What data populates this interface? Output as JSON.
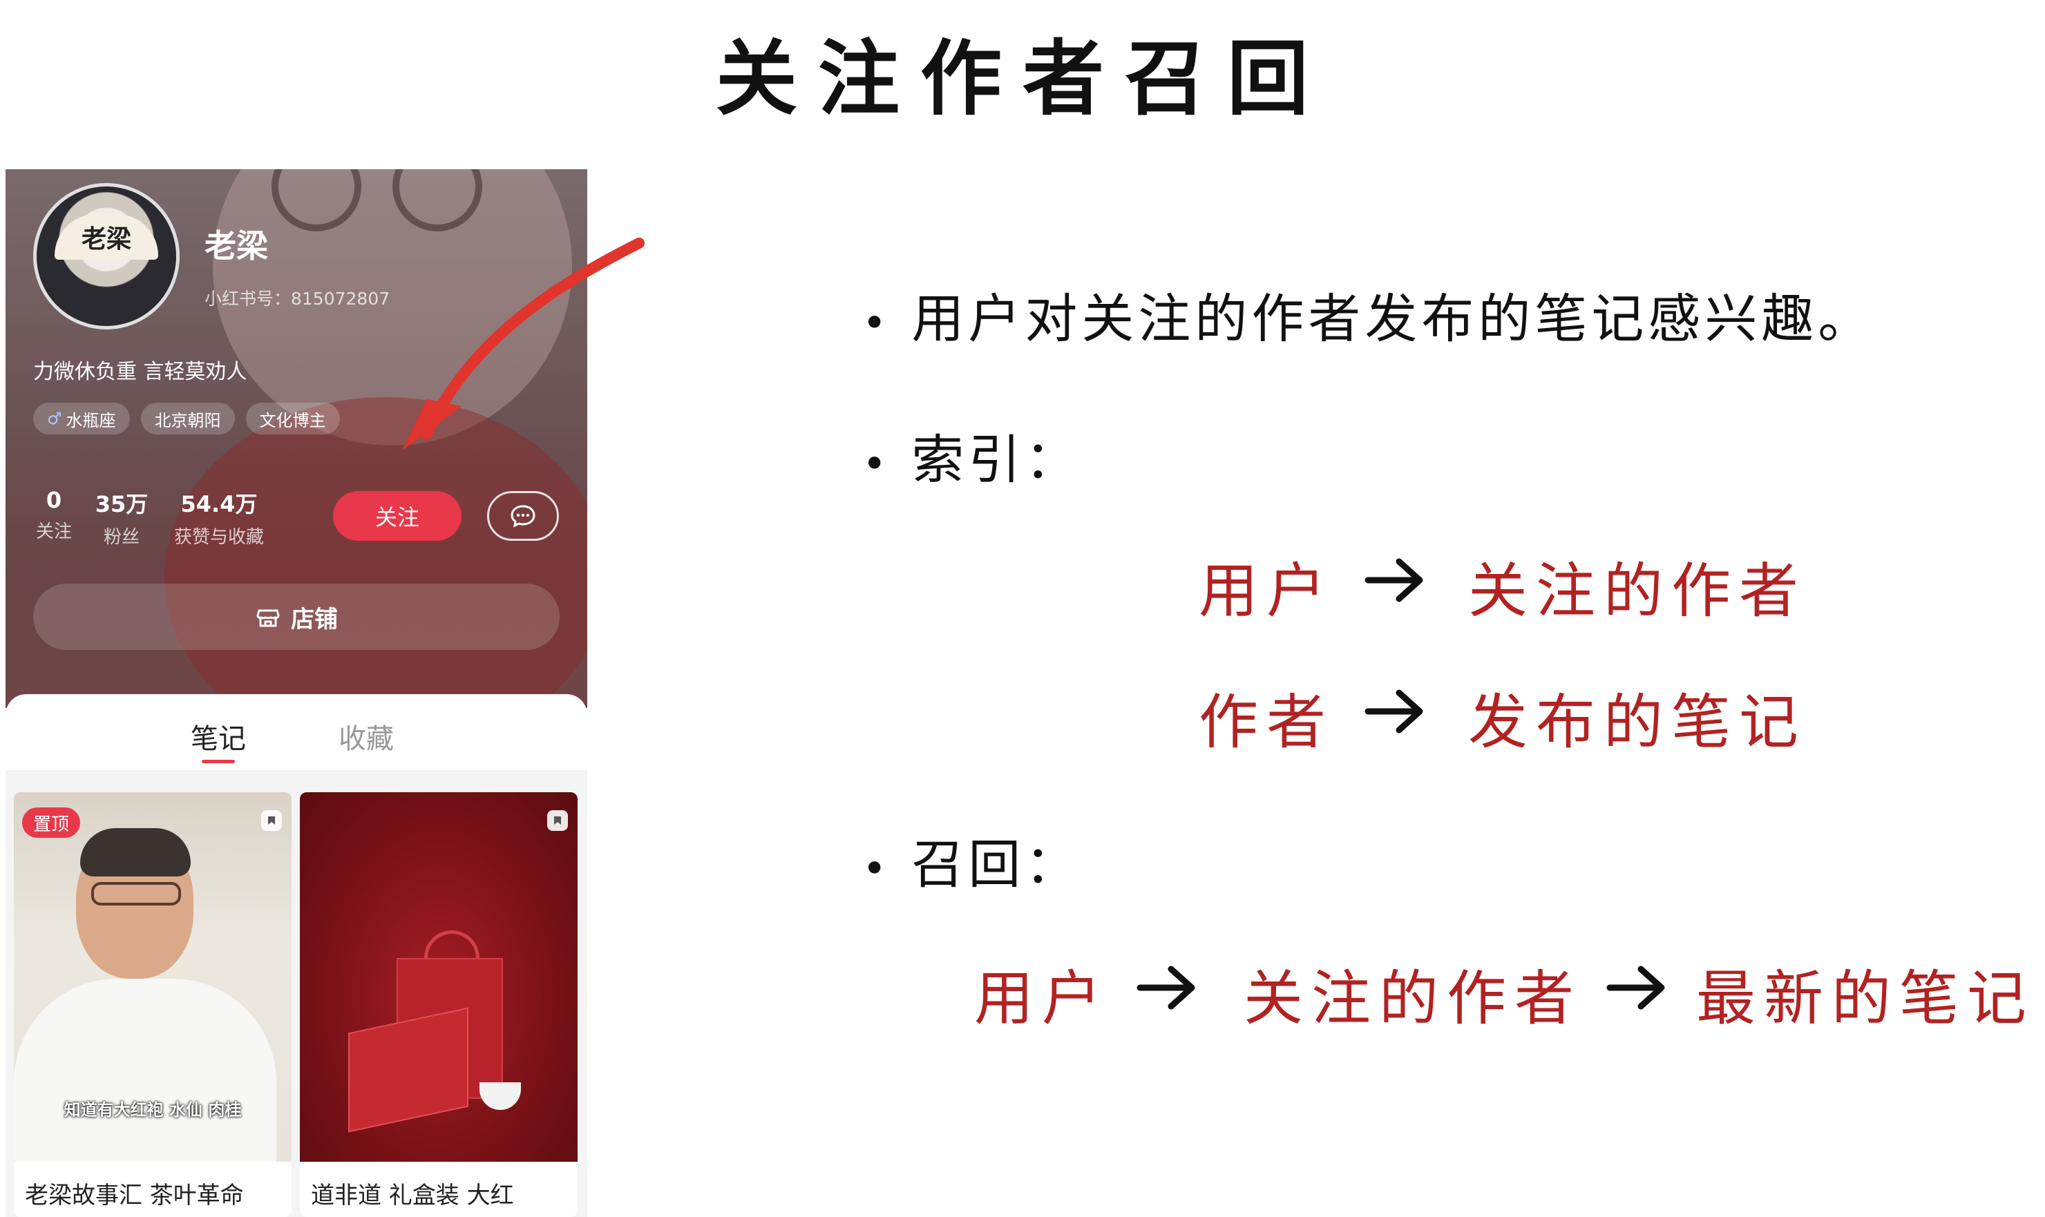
{
  "slide": {
    "title": "关注作者召回",
    "bullets": {
      "interest": "用户对关注的作者发布的笔记感兴趣。",
      "index": "索引：",
      "recall": "召回："
    },
    "index_rows": [
      {
        "from": "用户",
        "to": "关注的作者"
      },
      {
        "from": "作者",
        "to": "发布的笔记"
      }
    ],
    "recall_chain": [
      "用户",
      "关注的作者",
      "最新的笔记"
    ],
    "colors": {
      "accent_red": "#b22222",
      "annotation_arrow": "#e0342c"
    }
  },
  "profile": {
    "avatar_text": "老梁",
    "username": "老梁",
    "user_id": "小红书号：815072807",
    "bio": "力微休负重 言轻莫劝人",
    "tags": [
      {
        "icon": "male-icon",
        "label": "水瓶座"
      },
      {
        "label": "北京朝阳"
      },
      {
        "label": "文化博主"
      }
    ],
    "stats": [
      {
        "value": "0",
        "label": "关注"
      },
      {
        "value": "35万",
        "label": "粉丝"
      },
      {
        "value": "54.4万",
        "label": "获赞与收藏"
      }
    ],
    "follow_label": "关注",
    "store_label": "店铺",
    "brand_color": "#e8384a"
  },
  "tabs": {
    "notes": "笔记",
    "collections": "收藏"
  },
  "notes": [
    {
      "badge": "置顶",
      "cover_caption": "知道有大红袍 水仙 肉桂",
      "title": "老梁故事汇 茶叶革命"
    },
    {
      "title": "道非道 礼盒装 大红"
    }
  ]
}
